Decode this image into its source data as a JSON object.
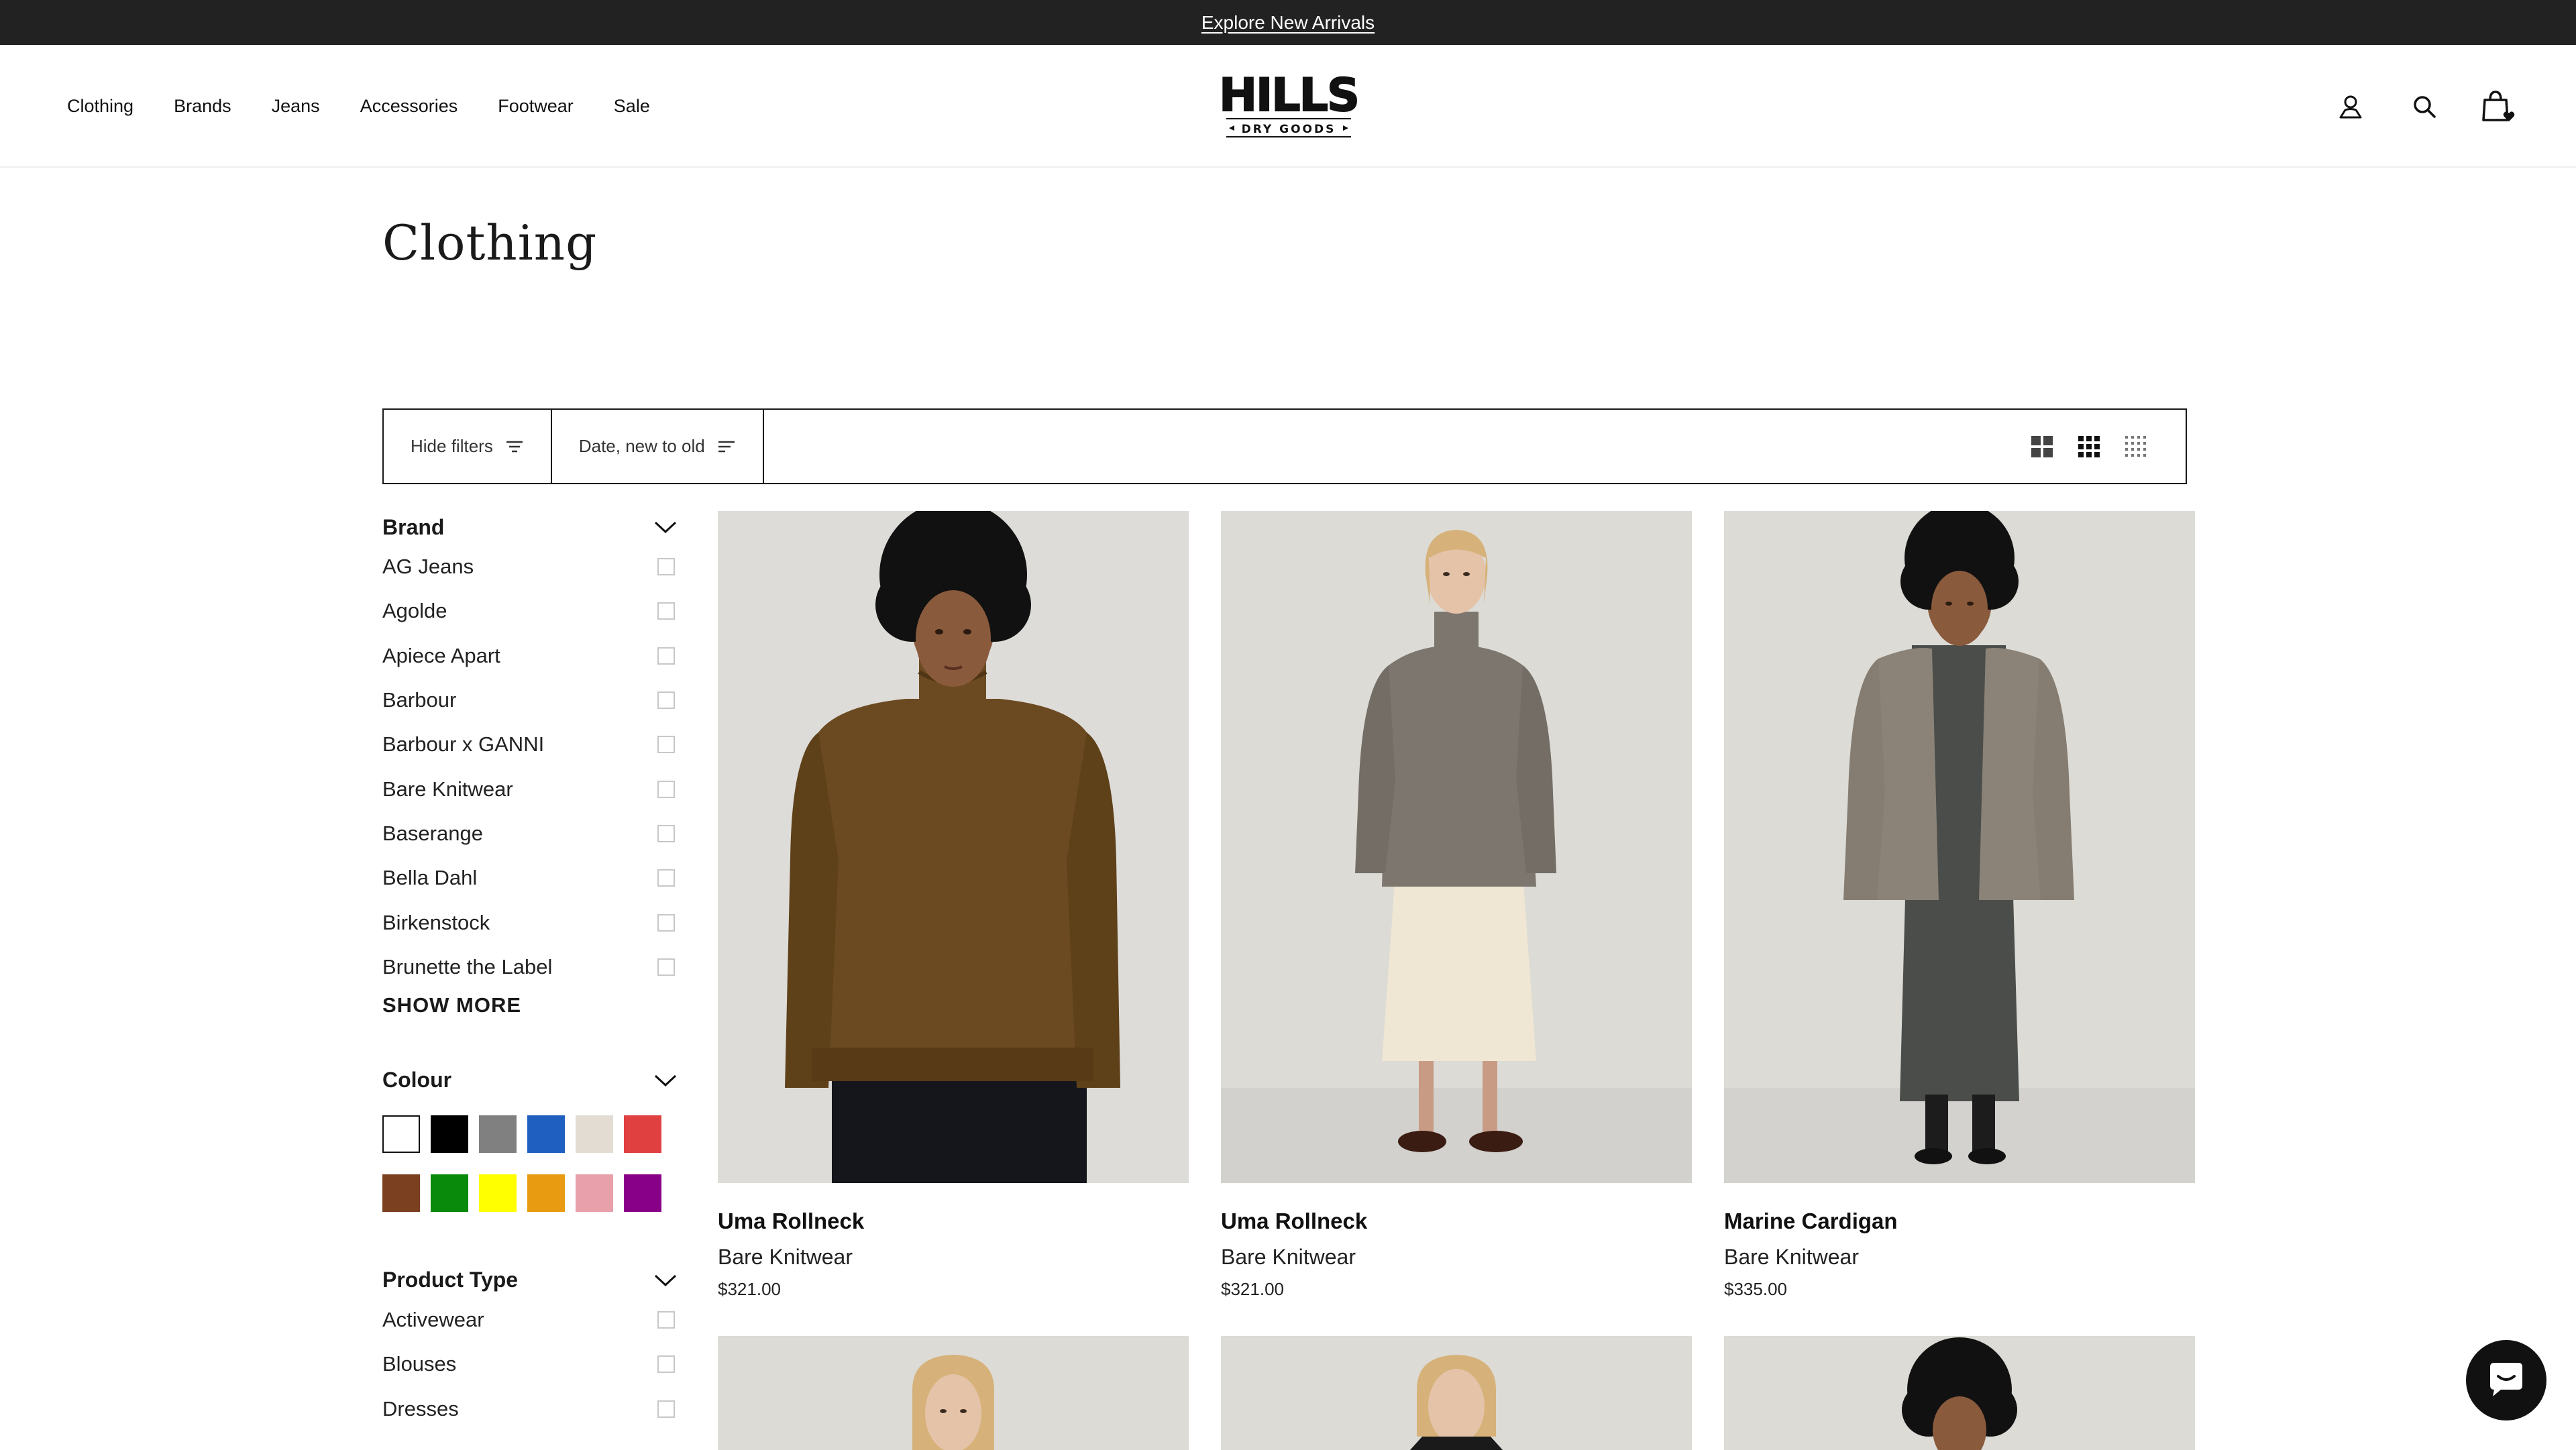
{
  "announcement": {
    "text": "Explore New Arrivals"
  },
  "nav": {
    "items": [
      "Clothing",
      "Brands",
      "Jeans",
      "Accessories",
      "Footwear",
      "Sale"
    ]
  },
  "logo": {
    "main": "HILLS",
    "sub": "DRY GOODS"
  },
  "header_icons": [
    "account-icon",
    "search-icon",
    "cart-icon"
  ],
  "page": {
    "title": "Clothing"
  },
  "toolbar": {
    "hide_filters": "Hide filters",
    "sort": "Date, new to old",
    "views": [
      "grid-large-icon",
      "grid-medium-icon",
      "grid-small-icon"
    ]
  },
  "filters": {
    "brand": {
      "title": "Brand",
      "items": [
        "AG Jeans",
        "Agolde",
        "Apiece Apart",
        "Barbour",
        "Barbour x GANNI",
        "Bare Knitwear",
        "Baserange",
        "Bella Dahl",
        "Birkenstock",
        "Brunette the Label"
      ],
      "show_more": "SHOW MORE"
    },
    "colour": {
      "title": "Colour",
      "swatches": [
        "#ffffff",
        "#000000",
        "#808080",
        "#1f5fbf",
        "#e2dcd3",
        "#e04040",
        "#7a4020",
        "#0a8a0a",
        "#ffff00",
        "#e89a10",
        "#e8a0aa",
        "#880088"
      ]
    },
    "product_type": {
      "title": "Product Type",
      "items": [
        "Activewear",
        "Blouses",
        "Dresses"
      ]
    }
  },
  "products": [
    {
      "name": "Uma Rollneck",
      "brand": "Bare Knitwear",
      "price": "$321.00"
    },
    {
      "name": "Uma Rollneck",
      "brand": "Bare Knitwear",
      "price": "$321.00"
    },
    {
      "name": "Marine Cardigan",
      "brand": "Bare Knitwear",
      "price": "$335.00"
    }
  ],
  "colors": {
    "announcement_bg": "#222222",
    "border": "#1a1a1a",
    "photo_bg": "#dcdbd7"
  }
}
